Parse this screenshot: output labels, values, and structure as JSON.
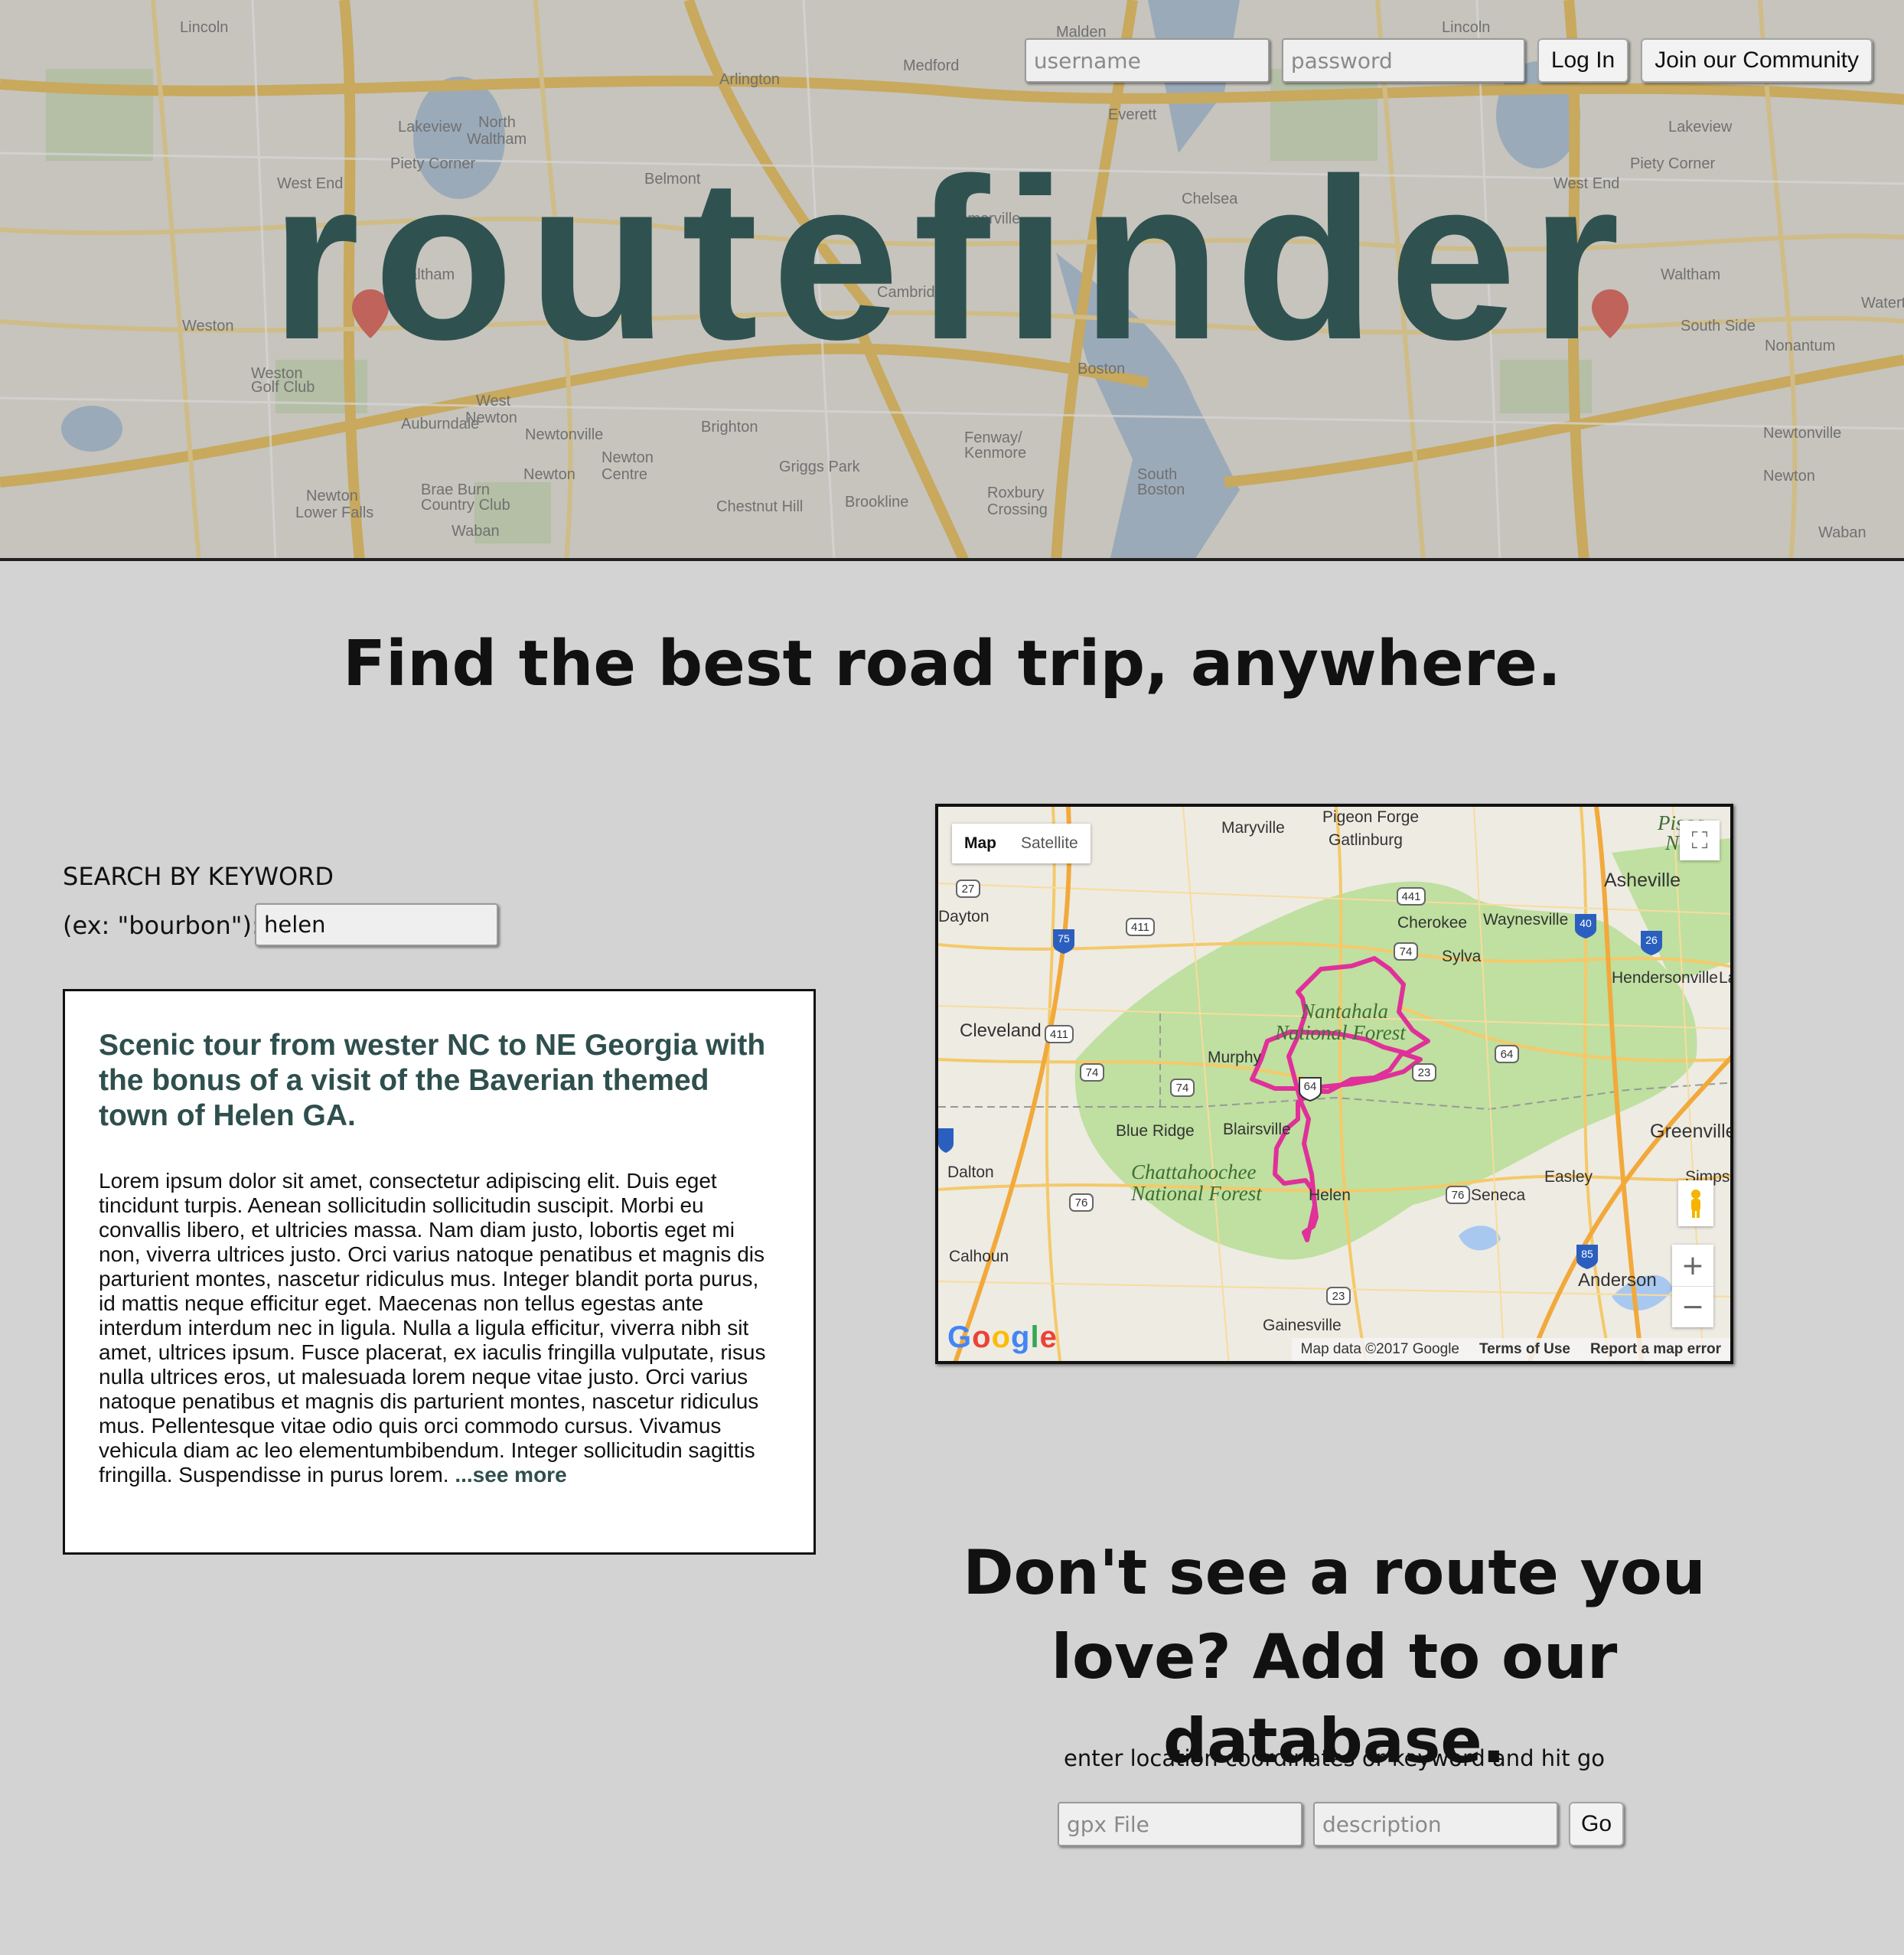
{
  "header": {
    "brand": "routefinder",
    "username_placeholder": "username",
    "password_placeholder": "password",
    "login_label": "Log In",
    "join_label": "Join our Community",
    "background_map_labels": [
      "Lincoln",
      "Arlington",
      "Medford",
      "Malden",
      "Everett",
      "Lakeview",
      "North Waltham",
      "Piety Corner",
      "West End",
      "Belmont",
      "Weston",
      "Waltham",
      "Somerville",
      "Cambridge",
      "Chelsea",
      "Boston",
      "Brighton",
      "Newton",
      "Brookline",
      "Auburndale",
      "Chestnut Hill",
      "Waban",
      "Newtonville",
      "Fenway/Kenmore",
      "Roxbury Crossing",
      "Griggs Park",
      "South Boston",
      "Watertown",
      "Nonantum",
      "Weston Golf Club",
      "West Newton",
      "Newton Centre",
      "Newton Lower Falls",
      "Brae Burn Country Club"
    ]
  },
  "tagline": "Find the best road trip, anywhere.",
  "search": {
    "label": "SEARCH BY KEYWORD",
    "example": "(ex: \"bourbon\"):",
    "value": "helen"
  },
  "result": {
    "title": "Scenic tour from wester NC to NE Georgia with the bonus of a visit of the Baverian themed town of Helen GA.",
    "description": "Lorem ipsum dolor sit amet, consectetur adipiscing elit. Duis eget tincidunt turpis. Aenean sollicitudin sollicitudin suscipit. Morbi eu convallis libero, et ultricies massa. Nam diam justo, lobortis eget mi non, viverra ultrices justo. Orci varius natoque penatibus et magnis dis parturient montes, nascetur ridiculus mus. Integer blandit porta purus, id mattis neque efficitur eget. Maecenas non tellus egestas ante interdum interdum nec in ligula. Nulla a ligula efficitur, viverra nibh sit amet, ultrices ipsum. Fusce placerat, ex iaculis fringilla vulputate, risus nulla ultrices eros, ut malesuada lorem neque vitae justo. Orci varius natoque penatibus et magnis dis parturient montes, nascetur ridiculus mus. Pellentesque vitae odio quis orci commodo cursus. Vivamus vehicula diam ac leo elementumbibendum. Integer sollicitudin sagittis fringilla. Suspendisse in purus lorem.",
    "see_more": "...see more"
  },
  "route_map": {
    "map_type_map": "Map",
    "map_type_satellite": "Satellite",
    "zoom_in": "+",
    "zoom_out": "−",
    "attribution": "Map data ©2017 Google",
    "terms": "Terms of Use",
    "report": "Report a map error",
    "logo": "Google",
    "route_color": "#e0309a",
    "forest_color": "#bfe0a0",
    "places": [
      "Maryville",
      "Pigeon Forge",
      "Gatlinburg",
      "Asheville",
      "Dayton",
      "Cherokee",
      "Waynesville",
      "Sylva",
      "Hendersonville",
      "Cleveland",
      "Nantahala National Forest",
      "Murphy",
      "Blue Ridge",
      "Blairsville",
      "Greenville",
      "Dalton",
      "Chattahoochee National Forest",
      "Helen",
      "Easley",
      "Seneca",
      "Calhoun",
      "Anderson",
      "Gainesville",
      "Pisgah National Forest",
      "Simpsonville",
      "Lake"
    ]
  },
  "add_route": {
    "heading": "Don't see a route you love? Add to our database.",
    "hint": "enter location coordinates or keyword and hit go",
    "gpx_placeholder": "gpx File",
    "description_placeholder": "description",
    "go_label": "Go"
  },
  "colors": {
    "page_bg": "#d3d3d3",
    "brand": "#2f5250",
    "card_title": "#2e4f4d"
  }
}
